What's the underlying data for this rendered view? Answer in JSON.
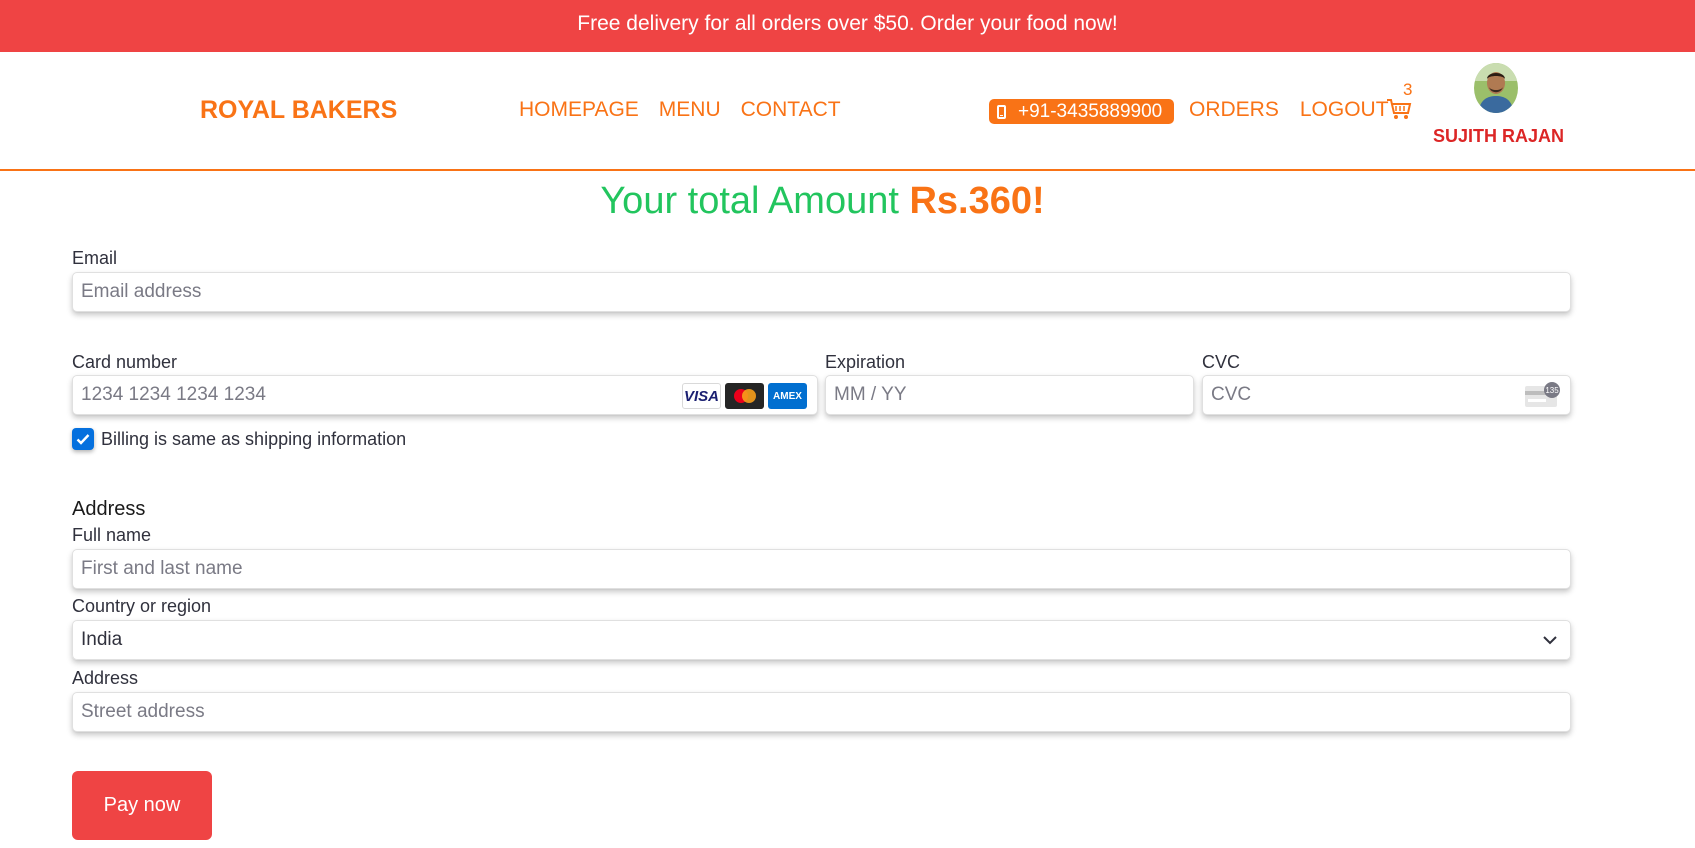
{
  "promo_banner": {
    "text": "Free delivery for all orders over $50. Order your food now!"
  },
  "navbar": {
    "brand": "ROYAL BAKERS",
    "links": [
      "HOMEPAGE",
      "MENU",
      "CONTACT"
    ],
    "phone": "+91-3435889900",
    "right_links": [
      "ORDERS",
      "LOGOUT"
    ],
    "cart_count": "3",
    "user_name": "SUJITH RAJAN"
  },
  "summary": {
    "prefix": "Your total Amount ",
    "amount": "Rs.360!"
  },
  "payment": {
    "email": {
      "label": "Email",
      "placeholder": "Email address",
      "value": ""
    },
    "card_number": {
      "label": "Card number",
      "placeholder": "1234 1234 1234 1234",
      "brands": [
        "VISA",
        "Mastercard",
        "AMEX"
      ]
    },
    "expiration": {
      "label": "Expiration",
      "placeholder": "MM / YY"
    },
    "cvc": {
      "label": "CVC",
      "placeholder": "CVC",
      "icon_text": "135"
    },
    "billing_same": {
      "label": "Billing is same as shipping information",
      "checked": true
    }
  },
  "address": {
    "section_title": "Address",
    "full_name": {
      "label": "Full name",
      "placeholder": "First and last name"
    },
    "country": {
      "label": "Country or region",
      "value": "India"
    },
    "street": {
      "label": "Address",
      "placeholder": "Street address"
    }
  },
  "actions": {
    "pay_label": "Pay now"
  },
  "colors": {
    "accent": "#f97316",
    "banner": "#ef4444",
    "total_text": "#22c55e",
    "user_name": "#dc2626",
    "checkbox": "#0570de"
  }
}
